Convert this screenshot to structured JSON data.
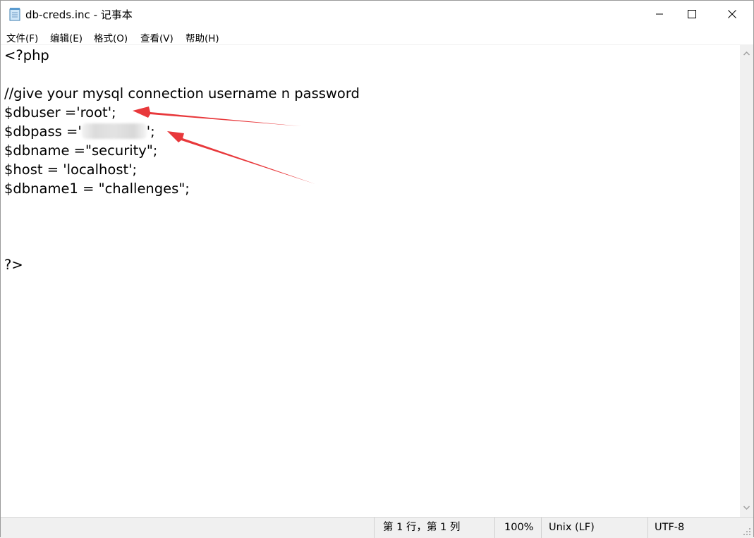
{
  "window": {
    "title": "db-creds.inc - 记事本",
    "icon": "notepad-icon",
    "controls": {
      "minimize_icon": "minimize-icon",
      "maximize_icon": "maximize-icon",
      "close_icon": "close-icon"
    }
  },
  "menu": {
    "items": [
      {
        "label": "文件(F)"
      },
      {
        "label": "编辑(E)"
      },
      {
        "label": "格式(O)"
      },
      {
        "label": "查看(V)"
      },
      {
        "label": "帮助(H)"
      }
    ]
  },
  "editor": {
    "lines": [
      "<?php",
      "",
      "//give your mysql connection username n password",
      "$dbuser ='root';",
      "$dbpass ='",
      "';",
      "$dbname =\"security\";",
      "$host = 'localhost';",
      "$dbname1 = \"challenges\";",
      "?>"
    ]
  },
  "annotations": {
    "arrow_color": "#e8383b"
  },
  "status": {
    "position": "第 1 行，第 1 列",
    "zoom": "100%",
    "line_ending": "Unix (LF)",
    "encoding": "UTF-8"
  }
}
